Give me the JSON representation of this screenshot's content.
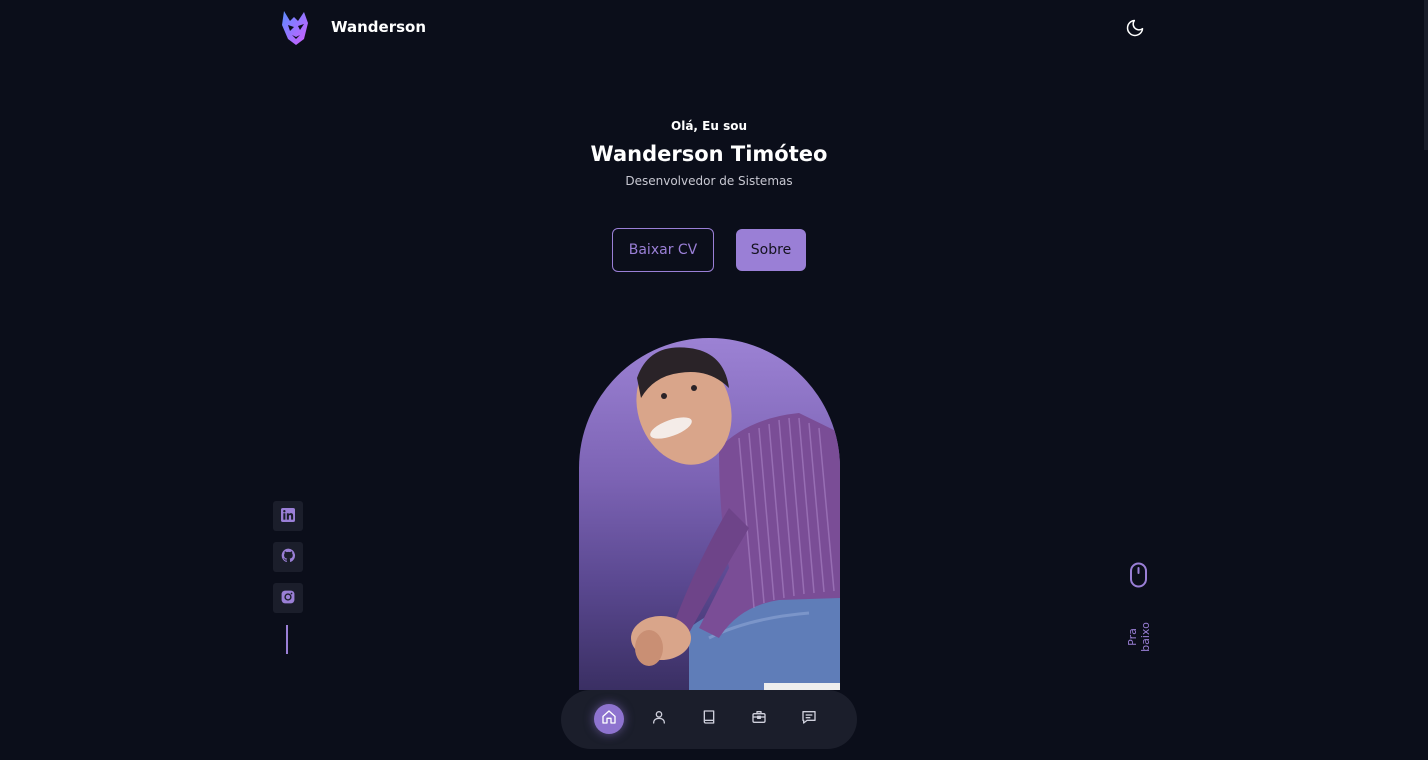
{
  "header": {
    "brand_name": "Wanderson",
    "logo_icon": "wolf-logo-icon",
    "theme_icon": "moon-icon"
  },
  "hero": {
    "greeting": "Olá, Eu sou",
    "name": "Wanderson Timóteo",
    "role": "Desenvolvedor de Sistemas",
    "btn_cv": "Baixar CV",
    "btn_about": "Sobre"
  },
  "social": [
    {
      "name": "linkedin",
      "icon": "linkedin-icon"
    },
    {
      "name": "github",
      "icon": "github-icon"
    },
    {
      "name": "instagram",
      "icon": "instagram-icon"
    }
  ],
  "scroll": {
    "label": "Pra baixo",
    "icon": "mouse-icon"
  },
  "nav": [
    {
      "icon": "home-icon",
      "active": true
    },
    {
      "icon": "user-icon",
      "active": false
    },
    {
      "icon": "book-icon",
      "active": false
    },
    {
      "icon": "briefcase-icon",
      "active": false
    },
    {
      "icon": "message-icon",
      "active": false
    }
  ],
  "colors": {
    "background": "#0b0e1a",
    "accent": "#9a7fd6",
    "surface": "#1b1e2b"
  }
}
